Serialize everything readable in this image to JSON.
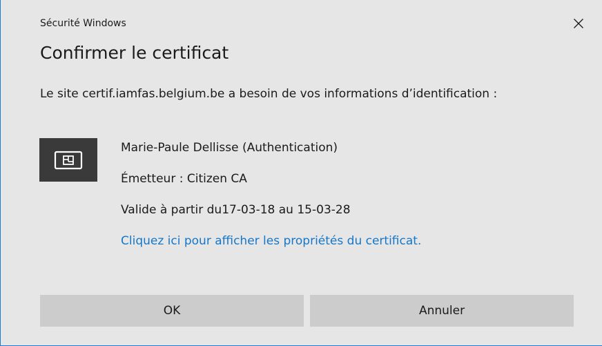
{
  "window": {
    "title": "Sécurité Windows",
    "close_icon": "close-icon"
  },
  "dialog": {
    "heading": "Confirmer le certificat",
    "message": "Le site certif.iamfas.belgium.be a besoin de vos informations d’identification :"
  },
  "certificate": {
    "icon": "certificate-card-icon",
    "name": "Marie-Paule Dellisse (Authentication)",
    "issuer": "Émetteur : Citizen CA",
    "validity": "Valide à partir du17-03-18 au 15-03-28",
    "properties_link": "Cliquez ici pour afficher les propriétés du certificat."
  },
  "buttons": {
    "ok_label": "OK",
    "cancel_label": "Annuler"
  },
  "colors": {
    "background": "#e6e6e6",
    "button": "#cccccc",
    "link": "#1677c8",
    "icon_tile": "#3a3a3a",
    "border_accent": "#1f7ad4"
  }
}
